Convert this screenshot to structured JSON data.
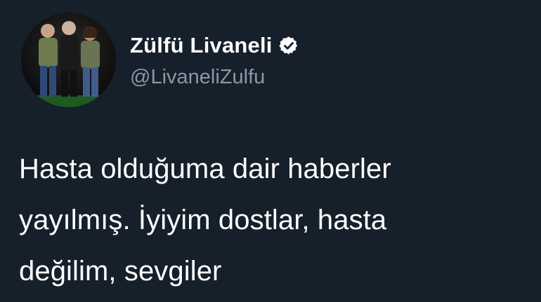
{
  "tweet": {
    "author": {
      "display_name": "Zülfü Livaneli",
      "handle": "@LivaneliZulfu",
      "verified": true,
      "avatar_icon": "profile-photo"
    },
    "text": "Hasta olduğuma dair haberler\nyayılmış.  İyiyim dostlar, hasta\ndeğilim, sevgiler"
  },
  "colors": {
    "background": "#15202b",
    "name": "#ffffff",
    "handle": "#8899a6",
    "text": "#ffffff",
    "verified_badge": "#ffffff"
  }
}
